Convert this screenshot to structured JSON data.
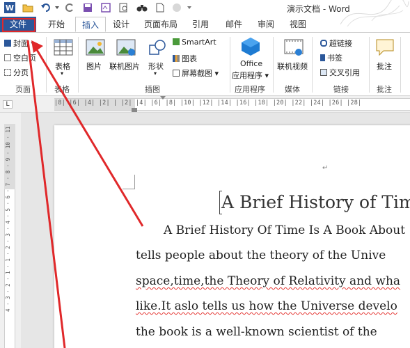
{
  "window": {
    "title": "演示文档 - Word"
  },
  "tabs": [
    {
      "label": "文件"
    },
    {
      "label": "开始"
    },
    {
      "label": "插入"
    },
    {
      "label": "设计"
    },
    {
      "label": "页面布局"
    },
    {
      "label": "引用"
    },
    {
      "label": "邮件"
    },
    {
      "label": "审阅"
    },
    {
      "label": "视图"
    }
  ],
  "ribbon": {
    "pages": {
      "items": [
        "封面",
        "空白页",
        "分页"
      ],
      "label": "页面"
    },
    "table": {
      "button": "表格",
      "label": "表格"
    },
    "illustrations": {
      "picture": "图片",
      "online_picture": "联机图片",
      "shapes": "形状",
      "smartart": "SmartArt",
      "chart": "图表",
      "screenshot": "屏幕截图",
      "label": "插图"
    },
    "apps": {
      "office": "Office",
      "app_store": "应用程序",
      "label": "应用程序"
    },
    "media": {
      "online_video": "联机视频",
      "label": "媒体"
    },
    "links": {
      "hyperlink": "超链接",
      "bookmark": "书签",
      "crossref": "交叉引用",
      "label": "链接"
    },
    "comments": {
      "comment": "批注",
      "label": "批注"
    }
  },
  "ruler": {
    "tab_selector": "L",
    "horizontal": "|8|  |6|  |4|  |2|  |  |2|  |4|  |6|  |8|  |10|  |12|  |14|  |16|  |18|  |20|  |22|  |24|  |26|  |28|",
    "vertical": "4 · 3 · 2 · 1 · 1 · 2 · 3 · 4 · 5 · 6 · 7 · 8 · 9 · 10 · 11"
  },
  "document": {
    "title": "A Brief History of Tim",
    "lines": [
      "A Brief History Of Time Is A Book About",
      "tells people about the theory of the Unive",
      "space,time,the Theory of Relativity and wha",
      "like.It aslo tells us how the Universe develo",
      "the book is a well-known scientist of the"
    ],
    "para_mark": "↵"
  },
  "colors": {
    "word_blue": "#2b579a",
    "highlight_red": "#e0282a",
    "squiggle_red": "#e53935"
  }
}
